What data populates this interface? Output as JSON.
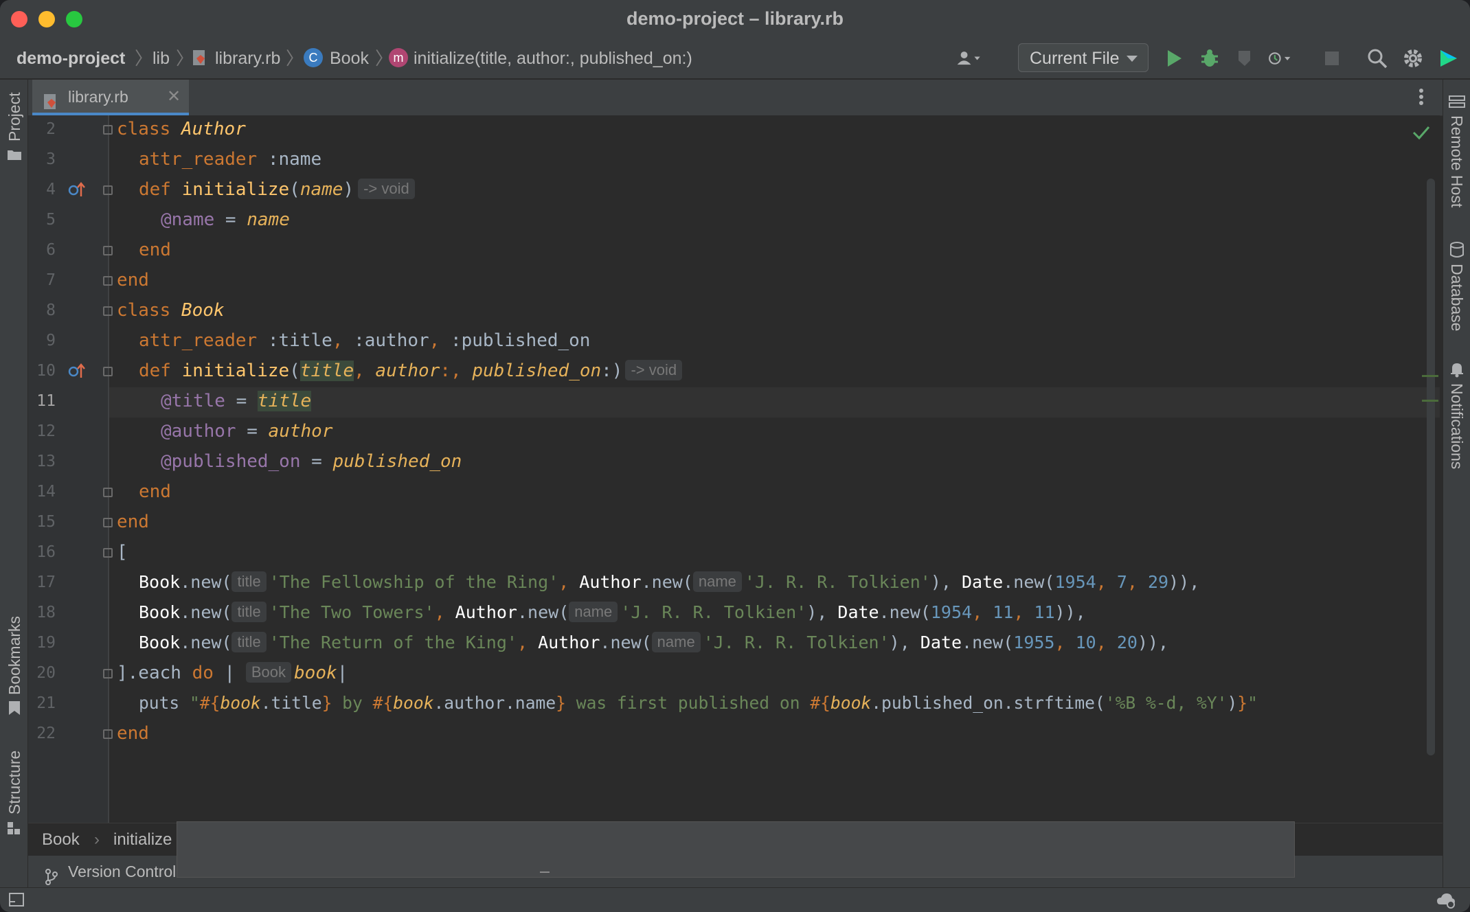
{
  "window": {
    "title": "demo-project – library.rb"
  },
  "navbar": {
    "project": "demo-project",
    "folder": "lib",
    "file": "library.rb",
    "class_badge": "C",
    "class_name": "Book",
    "method_badge": "m",
    "method_sig": "initialize(title, author:, published_on:)",
    "run_config": "Current File"
  },
  "left_tools": {
    "project": "Project",
    "bookmarks": "Bookmarks",
    "structure": "Structure"
  },
  "right_tools": {
    "remote_host": "Remote Host",
    "database": "Database",
    "notifications": "Notifications"
  },
  "tab": {
    "label": "library.rb"
  },
  "line_numbers": [
    "2",
    "3",
    "4",
    "5",
    "6",
    "7",
    "8",
    "9",
    "10",
    "11",
    "12",
    "13",
    "14",
    "15",
    "16",
    "17",
    "18",
    "19",
    "20",
    "21",
    "22"
  ],
  "code": {
    "l2": {
      "kw": "class ",
      "name": "Author"
    },
    "l3": {
      "kw": "attr_reader ",
      "rest": ":name"
    },
    "l4": {
      "kw": "def ",
      "fn": "initialize",
      "p1": "(",
      "param": "name",
      "p2": ")",
      "hint": "-> void"
    },
    "l5": {
      "iv": "@name",
      "op": " = ",
      "val": "name"
    },
    "l6": {
      "kw": "end"
    },
    "l7": {
      "kw": "end"
    },
    "l8": {
      "kw": "class ",
      "name": "Book"
    },
    "l9": {
      "kw": "attr_reader ",
      "s1": ":title",
      "c1": ", ",
      "s2": ":author",
      "c2": ", ",
      "s3": ":published_on"
    },
    "l10": {
      "kw": "def ",
      "fn": "initialize",
      "p1": "(",
      "a1": "title",
      "c1": ", ",
      "a2": "author",
      "c2": ":, ",
      "a3": "published_on",
      "p2": ":)",
      "hint": "-> void"
    },
    "l11": {
      "iv": "@title",
      "op": " = ",
      "val": "title"
    },
    "l12": {
      "iv": "@author",
      "op": " = ",
      "val": "author"
    },
    "l13": {
      "iv": "@published_on",
      "op": " = ",
      "val": "published_on"
    },
    "l14": {
      "kw": "end"
    },
    "l15": {
      "kw": "end"
    },
    "l16": {
      "text": "["
    },
    "l17": {
      "book": "Book",
      "new1": ".new(",
      "h1": "title",
      "s1": "'The Fellowship of the Ring'",
      "c1": ", ",
      "author": "Author",
      "new2": ".new(",
      "h2": "name",
      "s2": "'J. R. R. Tolkien'",
      "c2": "), ",
      "date": "Date",
      "new3": ".new(",
      "n1": "1954",
      "c3": ", ",
      "n2": "7",
      "c4": ", ",
      "n3": "29",
      "end": ")),"
    },
    "l18": {
      "book": "Book",
      "new1": ".new(",
      "h1": "title",
      "s1": "'The Two Towers'",
      "c1": ", ",
      "author": "Author",
      "new2": ".new(",
      "h2": "name",
      "s2": "'J. R. R. Tolkien'",
      "c2": "), ",
      "date": "Date",
      "new3": ".new(",
      "n1": "1954",
      "c3": ", ",
      "n2": "11",
      "c4": ", ",
      "n3": "11",
      "end": ")),"
    },
    "l19": {
      "book": "Book",
      "new1": ".new(",
      "h1": "title",
      "s1": "'The Return of the King'",
      "c1": ", ",
      "author": "Author",
      "new2": ".new(",
      "h2": "name",
      "s2": "'J. R. R. Tolkien'",
      "c2": "), ",
      "date": "Date",
      "new3": ".new(",
      "n1": "1955",
      "c3": ", ",
      "n2": "10",
      "c4": ", ",
      "n3": "20",
      "end": ")),"
    },
    "l20": {
      "pre": "].each ",
      "kw": "do",
      "bar1": " | ",
      "hint": "Book",
      "var": "book",
      "bar2": "|"
    },
    "l21": {
      "puts": "puts ",
      "q1": "\"",
      "i1": "#{",
      "v1": "book",
      "m1": ".title",
      "e1": "}",
      "t1": " by ",
      "i2": "#{",
      "v2": "book",
      "m2": ".author.name",
      "e2": "}",
      "t2": " was first published on ",
      "i3": "#{",
      "v3": "book",
      "m3": ".published_on.strftime(",
      "s": "'%B %-d, %Y'",
      "m4": ")",
      "e3": "}",
      "q2": "\""
    },
    "l22": {
      "kw": "end"
    }
  },
  "breadcrumb": {
    "item1": "Book",
    "item2": "initialize"
  },
  "toolwindow": {
    "vcs": "Version Control"
  },
  "colors": {
    "accent": "#4a88c7",
    "run_green": "#59a869",
    "keyword": "#cc7832",
    "string": "#6a8759",
    "number": "#6897bb"
  }
}
